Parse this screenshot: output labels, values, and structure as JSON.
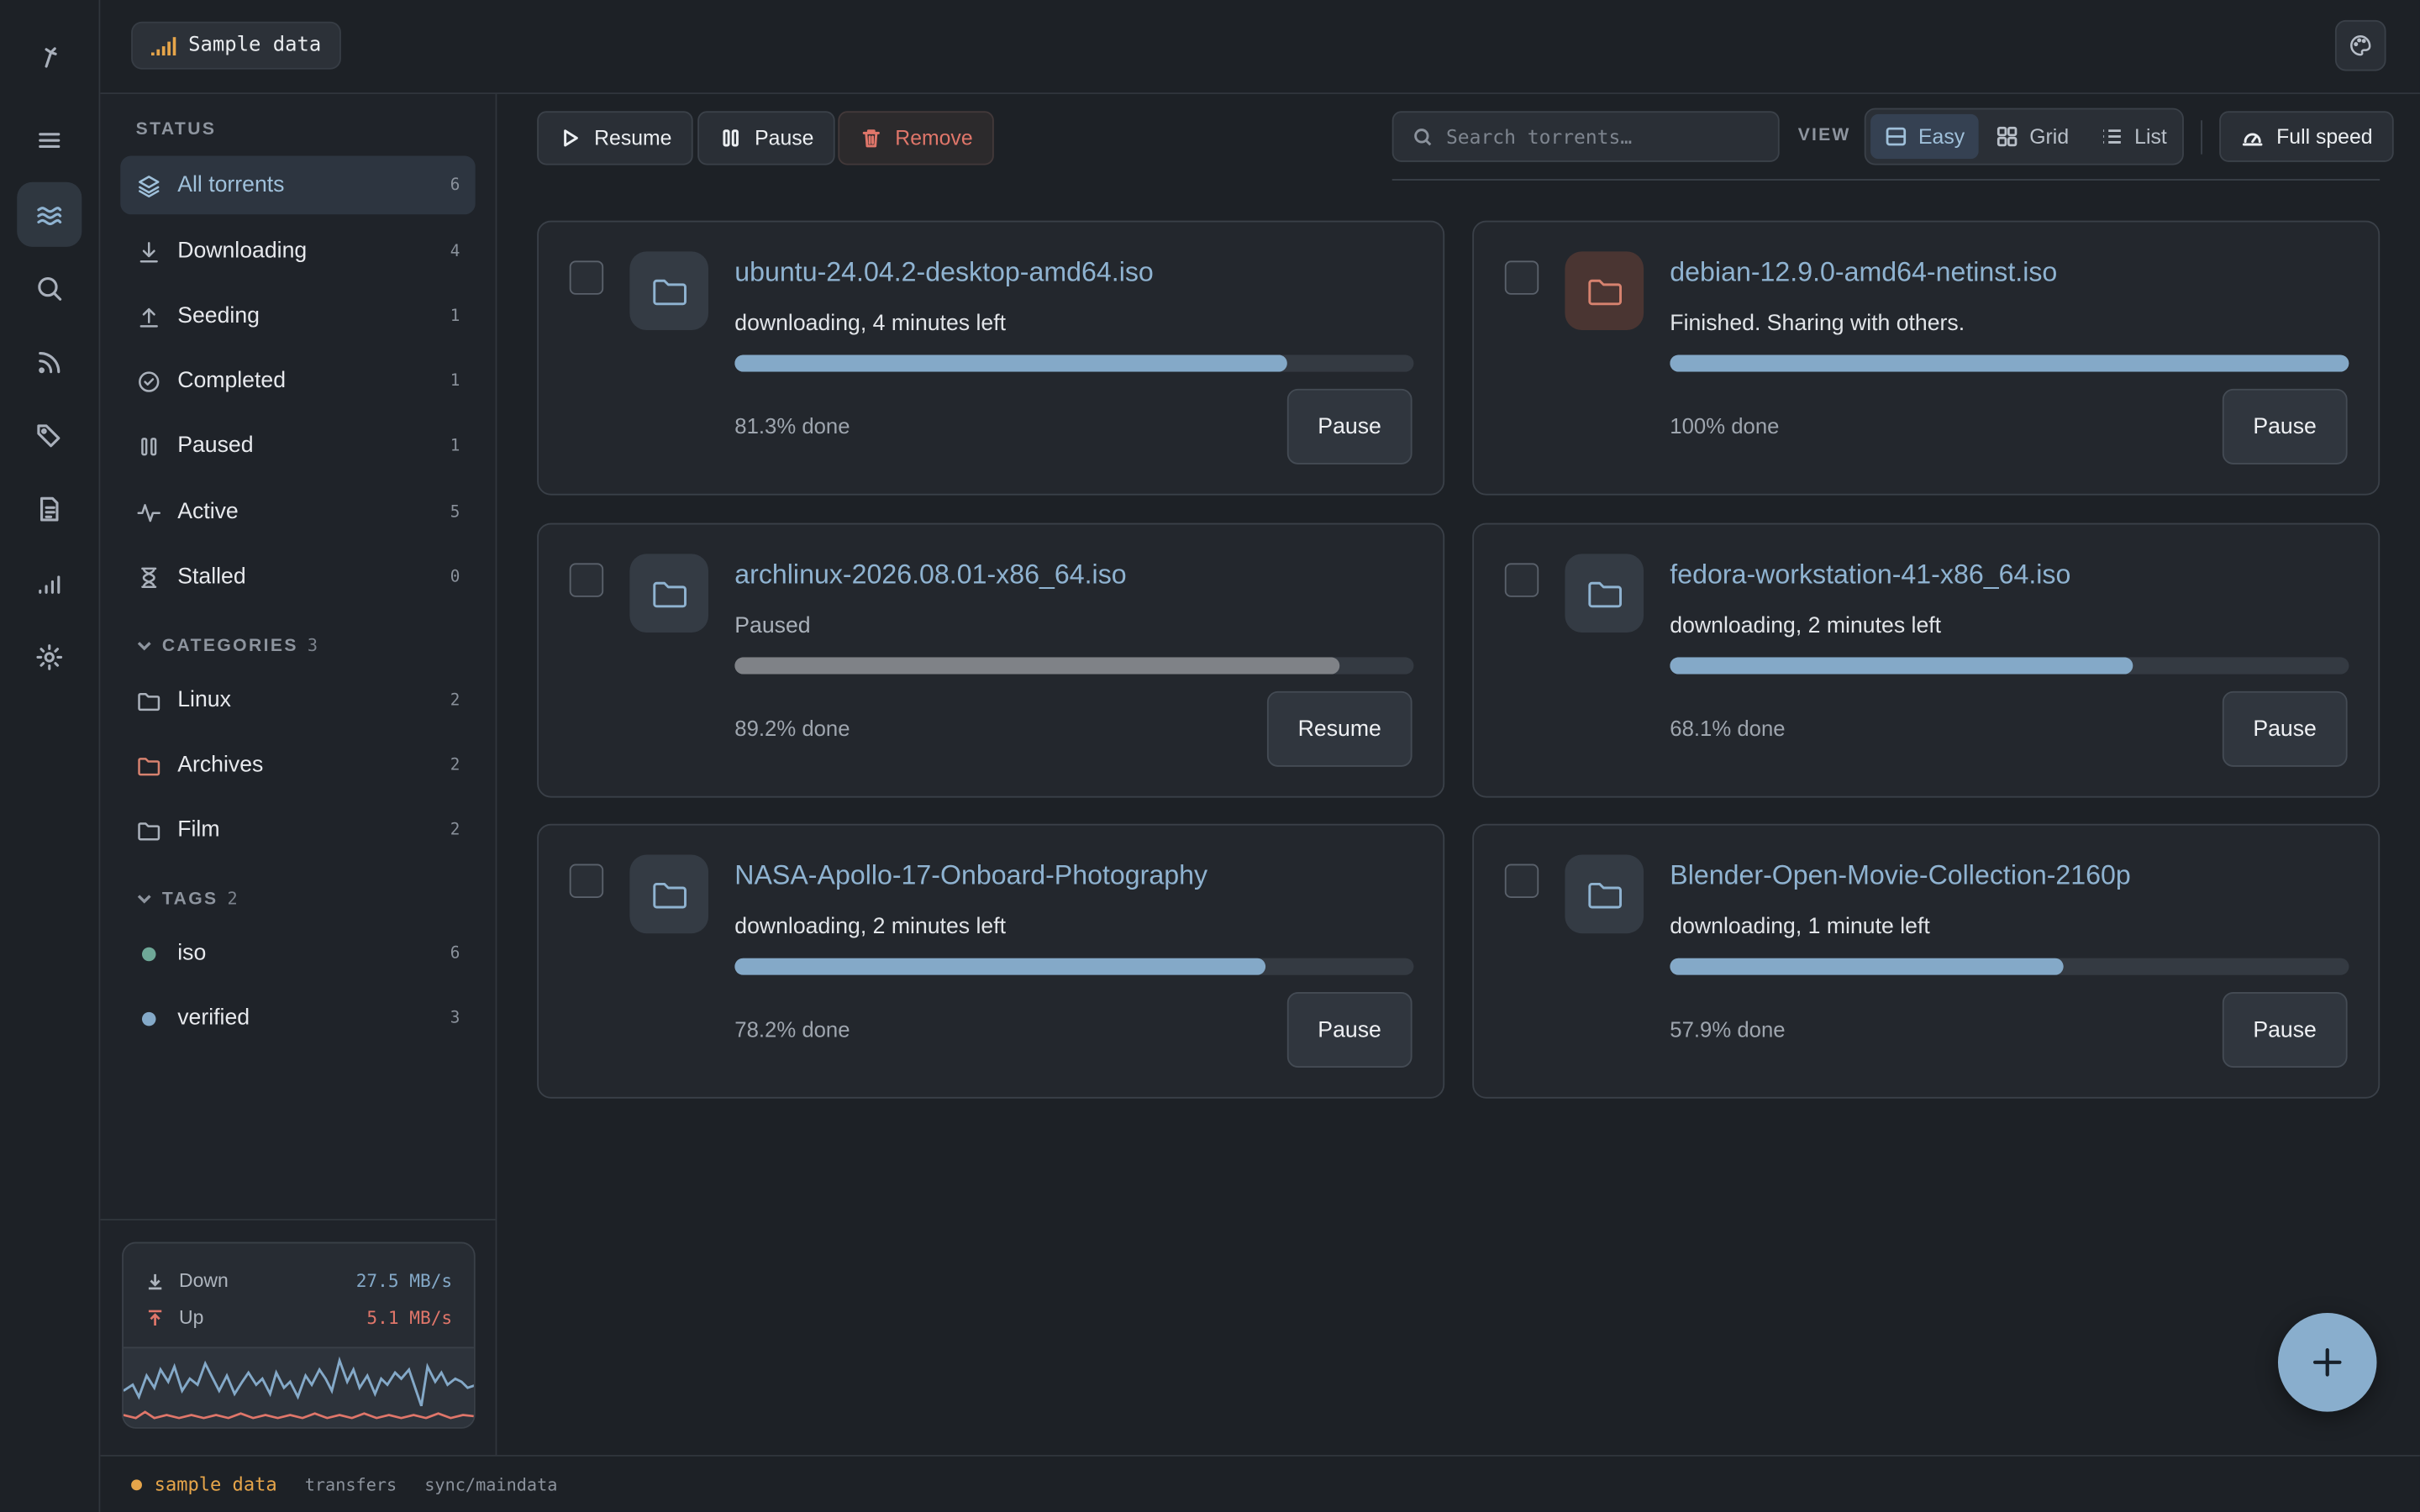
{
  "topbar": {
    "sample_chip": "Sample data"
  },
  "sidebar": {
    "status_header": "STATUS",
    "status_items": [
      {
        "label": "All torrents",
        "count": "6",
        "icon": "layers-icon"
      },
      {
        "label": "Downloading",
        "count": "4",
        "icon": "download-icon"
      },
      {
        "label": "Seeding",
        "count": "1",
        "icon": "upload-icon"
      },
      {
        "label": "Completed",
        "count": "1",
        "icon": "check-circle-icon"
      },
      {
        "label": "Paused",
        "count": "1",
        "icon": "pause-icon"
      },
      {
        "label": "Active",
        "count": "5",
        "icon": "activity-icon"
      },
      {
        "label": "Stalled",
        "count": "0",
        "icon": "hourglass-icon"
      }
    ],
    "categories_header": "CATEGORIES",
    "categories_count": "3",
    "categories": [
      {
        "label": "Linux",
        "count": "2",
        "color": "#aab1bb"
      },
      {
        "label": "Archives",
        "count": "2",
        "color": "#d7826f"
      },
      {
        "label": "Film",
        "count": "2",
        "color": "#aab1bb"
      }
    ],
    "tags_header": "TAGS",
    "tags_count": "2",
    "tags": [
      {
        "label": "iso",
        "count": "6",
        "color": "#6fa898"
      },
      {
        "label": "verified",
        "count": "3",
        "color": "#84a9c8"
      }
    ],
    "speed": {
      "down_label": "Down",
      "down_value": "27.5 MB/s",
      "up_label": "Up",
      "up_value": "5.1 MB/s",
      "down_color": "#84a9c8",
      "up_color": "#e0766a"
    }
  },
  "toolbar": {
    "resume": "Resume",
    "pause": "Pause",
    "remove": "Remove",
    "search_placeholder": "Search torrents…",
    "view_label": "VIEW",
    "views": [
      "Easy",
      "Grid",
      "List"
    ],
    "active_view": "Easy",
    "full_speed": "Full speed"
  },
  "torrents": [
    {
      "name": "ubuntu-24.04.2-desktop-amd64.iso",
      "status": "downloading, 4 minutes left",
      "progress": 0.813,
      "done": "81.3% done",
      "action": "Pause",
      "folder_color": "blue"
    },
    {
      "name": "debian-12.9.0-amd64-netinst.iso",
      "status": "Finished. Sharing with others.",
      "progress": 1.0,
      "done": "100% done",
      "action": "Pause",
      "folder_color": "orange"
    },
    {
      "name": "archlinux-2026.08.01-x86_64.iso",
      "status": "Paused",
      "progress": 0.892,
      "done": "89.2% done",
      "action": "Resume",
      "folder_color": "blue"
    },
    {
      "name": "fedora-workstation-41-x86_64.iso",
      "status": "downloading, 2 minutes left",
      "progress": 0.681,
      "done": "68.1% done",
      "action": "Pause",
      "folder_color": "blue"
    },
    {
      "name": "NASA-Apollo-17-Onboard-Photography",
      "status": "downloading, 2 minutes left",
      "progress": 0.782,
      "done": "78.2% done",
      "action": "Pause",
      "folder_color": "blue"
    },
    {
      "name": "Blender-Open-Movie-Collection-2160p",
      "status": "downloading, 1 minute left",
      "progress": 0.579,
      "done": "57.9% done",
      "action": "Pause",
      "folder_color": "blue"
    }
  ],
  "statusbar": {
    "mode": "sample data",
    "page": "transfers",
    "sync": "sync/maindata"
  },
  "colors": {
    "accent": "#84a9c8",
    "danger": "#e0766a",
    "warning": "#e6a54a",
    "background": "#1d2126"
  }
}
